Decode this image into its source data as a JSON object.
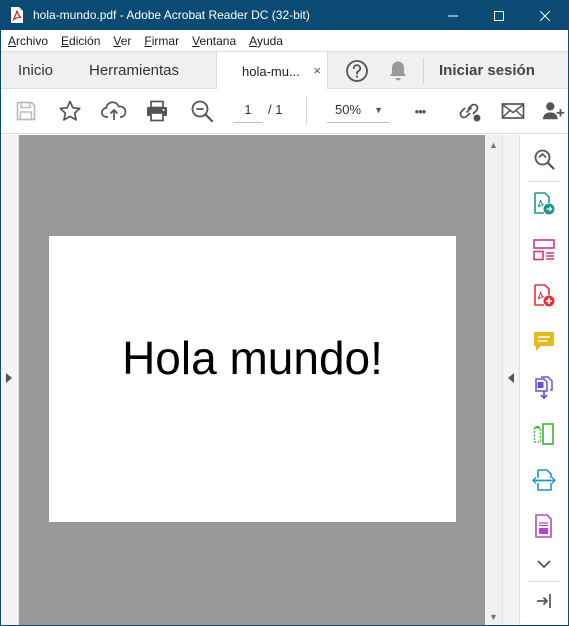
{
  "window": {
    "title": "hola-mundo.pdf - Adobe Acrobat Reader DC (32-bit)",
    "minimize_glyph": "—",
    "maximize_glyph": "☐",
    "close_glyph": "✕"
  },
  "menu": {
    "items": [
      {
        "label_rest": "rchivo",
        "mnemonic": "A"
      },
      {
        "label_rest": "dición",
        "mnemonic": "E"
      },
      {
        "label_rest": "er",
        "mnemonic": "V"
      },
      {
        "label_rest": "irmar",
        "mnemonic": "F"
      },
      {
        "label_rest": "entana",
        "mnemonic": "V"
      },
      {
        "label_rest": "yuda",
        "mnemonic": "A"
      }
    ]
  },
  "tabs": {
    "home": "Inicio",
    "tools": "Herramientas",
    "document": "hola-mu...",
    "close_glyph": "×",
    "signin": "Iniciar sesión"
  },
  "toolbar": {
    "current_page": "1",
    "total_pages": "/  1",
    "zoom": "50%",
    "zoom_arrow": "▼",
    "more": "•••"
  },
  "document": {
    "text": "Hola mundo!"
  },
  "scrollbar": {
    "up_glyph": "▲",
    "down_glyph": "▼"
  },
  "colors": {
    "titlebar": "#0a4a73",
    "canvas": "#999999",
    "icon_gray": "#555555",
    "export_teal": "#1a9a8c",
    "organize_pink": "#d9327e",
    "create_red": "#e0343b",
    "comment_yellow": "#e8b820",
    "combine_purple": "#6b4ee0",
    "compress_green": "#4bb345",
    "scan_teal": "#1a9abf",
    "stamp_magenta": "#b447c9"
  }
}
